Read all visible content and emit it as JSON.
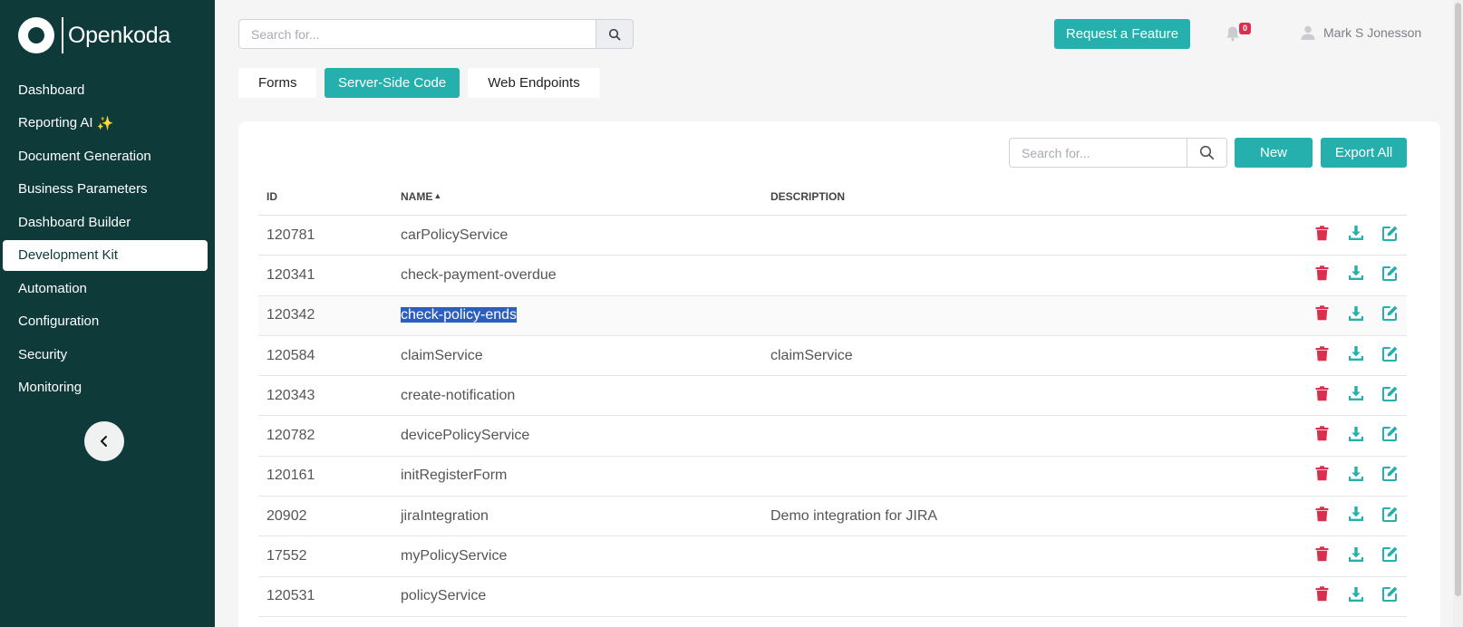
{
  "app": {
    "name": "Openkoda"
  },
  "sidebar": {
    "items": [
      {
        "label": "Dashboard",
        "name": "sidebar-item-dashboard"
      },
      {
        "label": "Reporting AI",
        "name": "sidebar-item-reporting-ai",
        "emoji": "✨"
      },
      {
        "label": "Document Generation",
        "name": "sidebar-item-document-generation"
      },
      {
        "label": "Business Parameters",
        "name": "sidebar-item-business-parameters"
      },
      {
        "label": "Dashboard Builder",
        "name": "sidebar-item-dashboard-builder"
      },
      {
        "label": "Development Kit",
        "name": "sidebar-item-development-kit",
        "active": true
      },
      {
        "label": "Automation",
        "name": "sidebar-item-automation"
      },
      {
        "label": "Configuration",
        "name": "sidebar-item-configuration"
      },
      {
        "label": "Security",
        "name": "sidebar-item-security"
      },
      {
        "label": "Monitoring",
        "name": "sidebar-item-monitoring"
      }
    ]
  },
  "header": {
    "search_placeholder": "Search for...",
    "request_feature_label": "Request a Feature",
    "notification_count": "0",
    "user_name": "Mark S Jonesson"
  },
  "tabs": [
    {
      "label": "Forms",
      "active": false
    },
    {
      "label": "Server-Side Code",
      "active": true
    },
    {
      "label": "Web Endpoints",
      "active": false
    }
  ],
  "table_toolbar": {
    "search_placeholder": "Search for...",
    "new_label": "New",
    "export_label": "Export All"
  },
  "table": {
    "columns": [
      "ID",
      "NAME",
      "DESCRIPTION"
    ],
    "sort_indicator": "▲",
    "rows": [
      {
        "id": "120781",
        "name": "carPolicyService",
        "description": ""
      },
      {
        "id": "120341",
        "name": "check-payment-overdue",
        "description": ""
      },
      {
        "id": "120342",
        "name": "check-policy-ends",
        "description": "",
        "selected": true
      },
      {
        "id": "120584",
        "name": "claimService",
        "description": "claimService"
      },
      {
        "id": "120343",
        "name": "create-notification",
        "description": ""
      },
      {
        "id": "120782",
        "name": "devicePolicyService",
        "description": ""
      },
      {
        "id": "120161",
        "name": "initRegisterForm",
        "description": ""
      },
      {
        "id": "20902",
        "name": "jiraIntegration",
        "description": "Demo integration for JIRA"
      },
      {
        "id": "17552",
        "name": "myPolicyService",
        "description": ""
      },
      {
        "id": "120531",
        "name": "policyService",
        "description": ""
      }
    ]
  },
  "colors": {
    "sidebar_bg": "#0e3a3a",
    "accent": "#25b0ad",
    "delete": "#d9304f"
  }
}
